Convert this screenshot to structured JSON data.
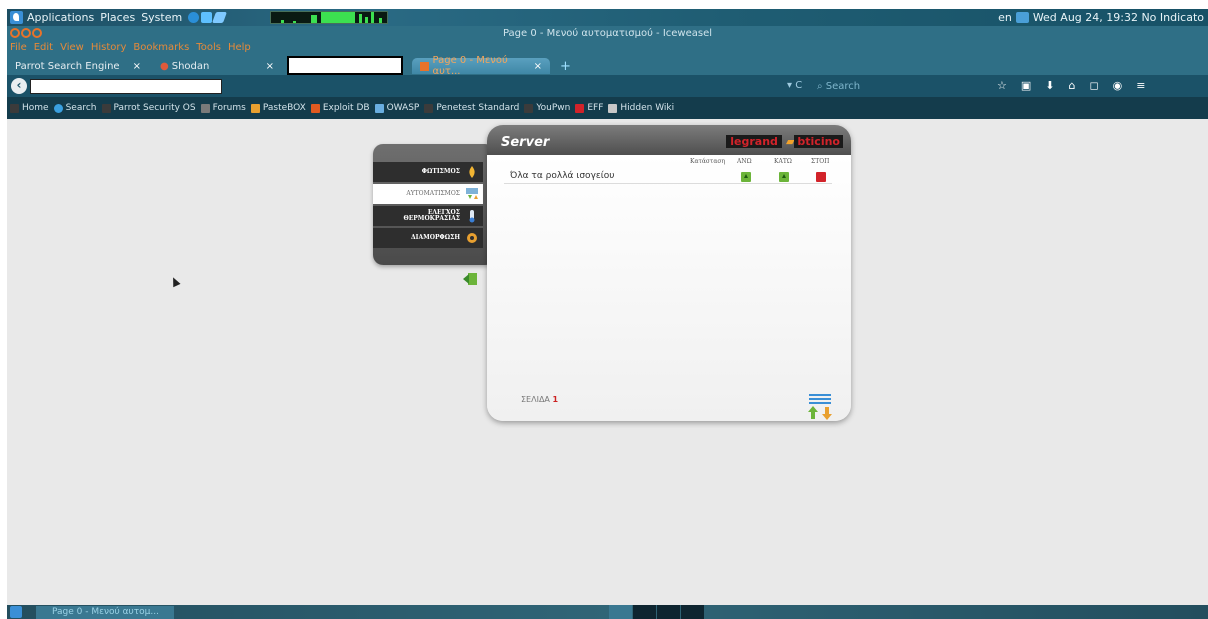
{
  "gnome_panel": {
    "menus": [
      "Applications",
      "Places",
      "System"
    ],
    "right_status": "en",
    "clock": "Wed Aug 24, 19:32 No Indicato"
  },
  "window": {
    "title": "Page 0 - Μενού αυτοματισμού - Iceweasel"
  },
  "menubar": [
    "File",
    "Edit",
    "View",
    "History",
    "Bookmarks",
    "Tools",
    "Help"
  ],
  "tabs": [
    {
      "label": "Parrot Search Engine",
      "close": "×"
    },
    {
      "label": "Shodan",
      "close": "×"
    },
    {
      "label": "Page 0 - Μενού αυτ...",
      "close": "×"
    }
  ],
  "new_tab_label": "+",
  "navbar": {
    "search_placeholder": "Search",
    "reload_glyph": "▾ C"
  },
  "bookmarks": [
    {
      "label": "Home",
      "color": "#3b3b3b"
    },
    {
      "label": "Search",
      "color": "#3aa0e0"
    },
    {
      "label": "Parrot Security OS",
      "color": "#3b3b3b"
    },
    {
      "label": "Forums",
      "color": "#7a7a7a"
    },
    {
      "label": "PasteBOX",
      "color": "#e8a030"
    },
    {
      "label": "Exploit DB",
      "color": "#e05a20"
    },
    {
      "label": "OWASP",
      "color": "#6aaee0"
    },
    {
      "label": "Penetest Standard",
      "color": "#3b3b3b"
    },
    {
      "label": "YouPwn",
      "color": "#3b3b3b"
    },
    {
      "label": "EFF",
      "color": "#d2232a"
    },
    {
      "label": "Hidden Wiki",
      "color": "#c8c8c8"
    }
  ],
  "side_menu": [
    {
      "label": "ΦΩΤΙΣΜΟΣ",
      "icon": "lightbulb-icon",
      "selected": false
    },
    {
      "label": "ΑΥΤΟΜΑΤΙΣΜΟΣ",
      "icon": "shutter-icon",
      "selected": true
    },
    {
      "label": "ΕΛΕΓΧΟΣ ΘΕΡΜΟΚΡΑΣΙΑΣ",
      "icon": "thermometer-icon",
      "selected": false
    },
    {
      "label": "ΔΙΑΜΟΡΦΩΣΗ",
      "icon": "gear-icon",
      "selected": false
    }
  ],
  "server_panel": {
    "title": "Server",
    "brand_1": "legrand",
    "brand_2": "bticino",
    "columns": {
      "status": "Κατάσταση",
      "up": "ΑΝΩ",
      "down": "ΚΑΤΩ",
      "stop": "ΣΤΟΠ"
    },
    "rows": [
      {
        "label": "Όλα τα ρολλά ισογείου"
      }
    ],
    "page_label": "ΣΕΛΙΔΑ",
    "page_number": "1"
  },
  "taskbar": {
    "task_label": "Page 0 - Μενού αυτομ..."
  },
  "colors": {
    "panel_teal": "#2f6f86",
    "menu_orange": "#e58a3a",
    "brand_red": "#d2232a",
    "up_green": "#6cb43a"
  }
}
